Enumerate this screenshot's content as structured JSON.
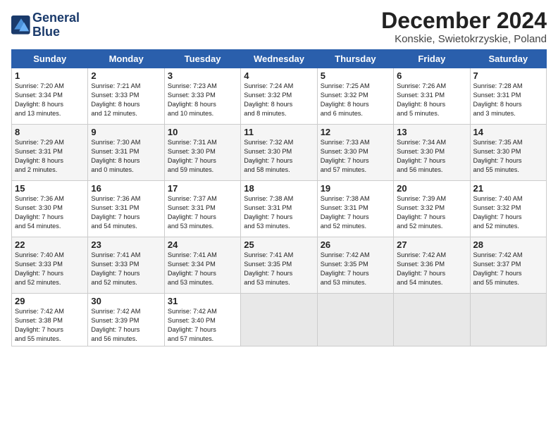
{
  "header": {
    "logo_line1": "General",
    "logo_line2": "Blue",
    "month": "December 2024",
    "location": "Konskie, Swietokrzyskie, Poland"
  },
  "weekdays": [
    "Sunday",
    "Monday",
    "Tuesday",
    "Wednesday",
    "Thursday",
    "Friday",
    "Saturday"
  ],
  "weeks": [
    [
      {
        "day": 1,
        "info": "Sunrise: 7:20 AM\nSunset: 3:34 PM\nDaylight: 8 hours\nand 13 minutes."
      },
      {
        "day": 2,
        "info": "Sunrise: 7:21 AM\nSunset: 3:33 PM\nDaylight: 8 hours\nand 12 minutes."
      },
      {
        "day": 3,
        "info": "Sunrise: 7:23 AM\nSunset: 3:33 PM\nDaylight: 8 hours\nand 10 minutes."
      },
      {
        "day": 4,
        "info": "Sunrise: 7:24 AM\nSunset: 3:32 PM\nDaylight: 8 hours\nand 8 minutes."
      },
      {
        "day": 5,
        "info": "Sunrise: 7:25 AM\nSunset: 3:32 PM\nDaylight: 8 hours\nand 6 minutes."
      },
      {
        "day": 6,
        "info": "Sunrise: 7:26 AM\nSunset: 3:31 PM\nDaylight: 8 hours\nand 5 minutes."
      },
      {
        "day": 7,
        "info": "Sunrise: 7:28 AM\nSunset: 3:31 PM\nDaylight: 8 hours\nand 3 minutes."
      }
    ],
    [
      {
        "day": 8,
        "info": "Sunrise: 7:29 AM\nSunset: 3:31 PM\nDaylight: 8 hours\nand 2 minutes."
      },
      {
        "day": 9,
        "info": "Sunrise: 7:30 AM\nSunset: 3:31 PM\nDaylight: 8 hours\nand 0 minutes."
      },
      {
        "day": 10,
        "info": "Sunrise: 7:31 AM\nSunset: 3:30 PM\nDaylight: 7 hours\nand 59 minutes."
      },
      {
        "day": 11,
        "info": "Sunrise: 7:32 AM\nSunset: 3:30 PM\nDaylight: 7 hours\nand 58 minutes."
      },
      {
        "day": 12,
        "info": "Sunrise: 7:33 AM\nSunset: 3:30 PM\nDaylight: 7 hours\nand 57 minutes."
      },
      {
        "day": 13,
        "info": "Sunrise: 7:34 AM\nSunset: 3:30 PM\nDaylight: 7 hours\nand 56 minutes."
      },
      {
        "day": 14,
        "info": "Sunrise: 7:35 AM\nSunset: 3:30 PM\nDaylight: 7 hours\nand 55 minutes."
      }
    ],
    [
      {
        "day": 15,
        "info": "Sunrise: 7:36 AM\nSunset: 3:30 PM\nDaylight: 7 hours\nand 54 minutes."
      },
      {
        "day": 16,
        "info": "Sunrise: 7:36 AM\nSunset: 3:31 PM\nDaylight: 7 hours\nand 54 minutes."
      },
      {
        "day": 17,
        "info": "Sunrise: 7:37 AM\nSunset: 3:31 PM\nDaylight: 7 hours\nand 53 minutes."
      },
      {
        "day": 18,
        "info": "Sunrise: 7:38 AM\nSunset: 3:31 PM\nDaylight: 7 hours\nand 53 minutes."
      },
      {
        "day": 19,
        "info": "Sunrise: 7:38 AM\nSunset: 3:31 PM\nDaylight: 7 hours\nand 52 minutes."
      },
      {
        "day": 20,
        "info": "Sunrise: 7:39 AM\nSunset: 3:32 PM\nDaylight: 7 hours\nand 52 minutes."
      },
      {
        "day": 21,
        "info": "Sunrise: 7:40 AM\nSunset: 3:32 PM\nDaylight: 7 hours\nand 52 minutes."
      }
    ],
    [
      {
        "day": 22,
        "info": "Sunrise: 7:40 AM\nSunset: 3:33 PM\nDaylight: 7 hours\nand 52 minutes."
      },
      {
        "day": 23,
        "info": "Sunrise: 7:41 AM\nSunset: 3:33 PM\nDaylight: 7 hours\nand 52 minutes."
      },
      {
        "day": 24,
        "info": "Sunrise: 7:41 AM\nSunset: 3:34 PM\nDaylight: 7 hours\nand 53 minutes."
      },
      {
        "day": 25,
        "info": "Sunrise: 7:41 AM\nSunset: 3:35 PM\nDaylight: 7 hours\nand 53 minutes."
      },
      {
        "day": 26,
        "info": "Sunrise: 7:42 AM\nSunset: 3:35 PM\nDaylight: 7 hours\nand 53 minutes."
      },
      {
        "day": 27,
        "info": "Sunrise: 7:42 AM\nSunset: 3:36 PM\nDaylight: 7 hours\nand 54 minutes."
      },
      {
        "day": 28,
        "info": "Sunrise: 7:42 AM\nSunset: 3:37 PM\nDaylight: 7 hours\nand 55 minutes."
      }
    ],
    [
      {
        "day": 29,
        "info": "Sunrise: 7:42 AM\nSunset: 3:38 PM\nDaylight: 7 hours\nand 55 minutes."
      },
      {
        "day": 30,
        "info": "Sunrise: 7:42 AM\nSunset: 3:39 PM\nDaylight: 7 hours\nand 56 minutes."
      },
      {
        "day": 31,
        "info": "Sunrise: 7:42 AM\nSunset: 3:40 PM\nDaylight: 7 hours\nand 57 minutes."
      },
      null,
      null,
      null,
      null
    ]
  ]
}
